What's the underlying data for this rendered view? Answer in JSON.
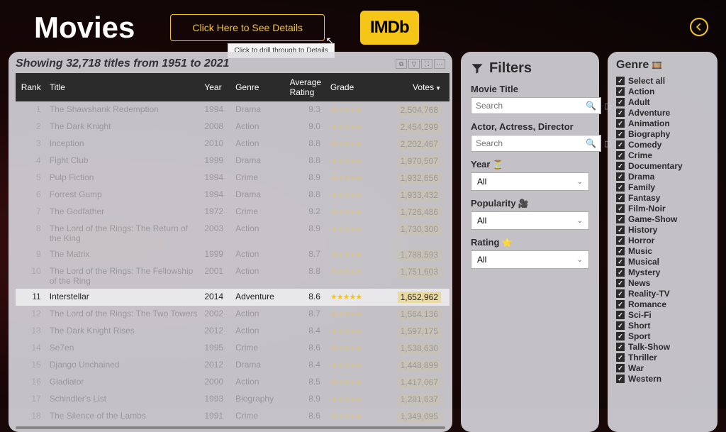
{
  "header": {
    "title": "Movies",
    "details_button": "Click Here to See Details",
    "tooltip": "Click to drill through to Details",
    "imdb": "IMDb"
  },
  "table": {
    "showing": "Showing 32,718 titles from 1951 to 2021",
    "columns": {
      "rank": "Rank",
      "title": "Title",
      "year": "Year",
      "genre": "Genre",
      "rating": "Average Rating",
      "grade": "Grade",
      "votes": "Votes"
    },
    "rows": [
      {
        "rank": 1,
        "title": "The Shawshank Redemption",
        "year": 1994,
        "genre": "Drama",
        "rating": 9.3,
        "votes": "2,504,768",
        "hl": false
      },
      {
        "rank": 2,
        "title": "The Dark Knight",
        "year": 2008,
        "genre": "Action",
        "rating": 9.0,
        "votes": "2,454,299",
        "hl": false
      },
      {
        "rank": 3,
        "title": "Inception",
        "year": 2010,
        "genre": "Action",
        "rating": 8.8,
        "votes": "2,202,467",
        "hl": false
      },
      {
        "rank": 4,
        "title": "Fight Club",
        "year": 1999,
        "genre": "Drama",
        "rating": 8.8,
        "votes": "1,970,507",
        "hl": false
      },
      {
        "rank": 5,
        "title": "Pulp Fiction",
        "year": 1994,
        "genre": "Crime",
        "rating": 8.9,
        "votes": "1,932,656",
        "hl": false
      },
      {
        "rank": 6,
        "title": "Forrest Gump",
        "year": 1994,
        "genre": "Drama",
        "rating": 8.8,
        "votes": "1,933,432",
        "hl": false
      },
      {
        "rank": 7,
        "title": "The Godfather",
        "year": 1972,
        "genre": "Crime",
        "rating": 9.2,
        "votes": "1,726,486",
        "hl": false
      },
      {
        "rank": 8,
        "title": "The Lord of the Rings: The Return of the King",
        "year": 2003,
        "genre": "Action",
        "rating": 8.9,
        "votes": "1,730,300",
        "hl": false
      },
      {
        "rank": 9,
        "title": "The Matrix",
        "year": 1999,
        "genre": "Action",
        "rating": 8.7,
        "votes": "1,788,593",
        "hl": false
      },
      {
        "rank": 10,
        "title": "The Lord of the Rings: The Fellowship of the Ring",
        "year": 2001,
        "genre": "Action",
        "rating": 8.8,
        "votes": "1,751,603",
        "hl": false
      },
      {
        "rank": 11,
        "title": "Interstellar",
        "year": 2014,
        "genre": "Adventure",
        "rating": 8.6,
        "votes": "1,652,962",
        "hl": true
      },
      {
        "rank": 12,
        "title": "The Lord of the Rings: The Two Towers",
        "year": 2002,
        "genre": "Action",
        "rating": 8.7,
        "votes": "1,564,136",
        "hl": false
      },
      {
        "rank": 13,
        "title": "The Dark Knight Rises",
        "year": 2012,
        "genre": "Action",
        "rating": 8.4,
        "votes": "1,597,175",
        "hl": false
      },
      {
        "rank": 14,
        "title": "Se7en",
        "year": 1995,
        "genre": "Crime",
        "rating": 8.6,
        "votes": "1,538,630",
        "hl": false
      },
      {
        "rank": 15,
        "title": "Django Unchained",
        "year": 2012,
        "genre": "Drama",
        "rating": 8.4,
        "votes": "1,448,899",
        "hl": false
      },
      {
        "rank": 16,
        "title": "Gladiator",
        "year": 2000,
        "genre": "Action",
        "rating": 8.5,
        "votes": "1,417,067",
        "hl": false
      },
      {
        "rank": 17,
        "title": "Schindler's List",
        "year": 1993,
        "genre": "Biography",
        "rating": 8.9,
        "votes": "1,281,637",
        "hl": false
      },
      {
        "rank": 18,
        "title": "The Silence of the Lambs",
        "year": 1991,
        "genre": "Crime",
        "rating": 8.6,
        "votes": "1,349,095",
        "hl": false
      }
    ]
  },
  "filters": {
    "title": "Filters",
    "movie_title_label": "Movie Title",
    "person_label": "Actor, Actress, Director",
    "search_placeholder": "Search",
    "year_label": "Year",
    "popularity_label": "Popularity",
    "rating_label": "Rating",
    "all": "All"
  },
  "genre": {
    "title": "Genre",
    "items": [
      "Select all",
      "Action",
      "Adult",
      "Adventure",
      "Animation",
      "Biography",
      "Comedy",
      "Crime",
      "Documentary",
      "Drama",
      "Family",
      "Fantasy",
      "Film-Noir",
      "Game-Show",
      "History",
      "Horror",
      "Music",
      "Musical",
      "Mystery",
      "News",
      "Reality-TV",
      "Romance",
      "Sci-Fi",
      "Short",
      "Sport",
      "Talk-Show",
      "Thriller",
      "War",
      "Western"
    ]
  }
}
